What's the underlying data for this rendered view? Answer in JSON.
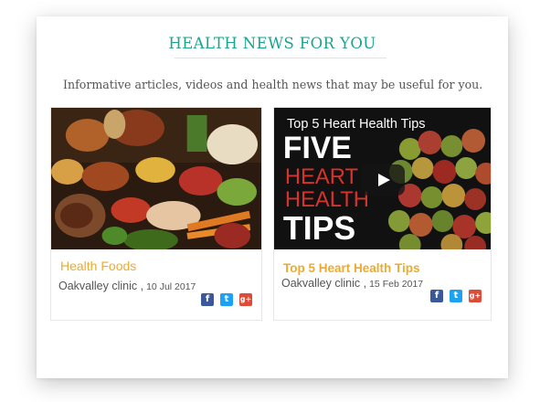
{
  "section": {
    "title": "HEALTH NEWS FOR YOU",
    "subtitle": "Informative articles, videos and health news that may be useful for you."
  },
  "articles": [
    {
      "title": "Health Foods",
      "source": "Oakvalley clinic ,",
      "date": "10 Jul 2017",
      "share": [
        "facebook-icon",
        "twitter-icon",
        "google-plus-icon"
      ]
    },
    {
      "title": "Top 5 Heart Health Tips",
      "source": "Oakvalley clinic ,",
      "date": "15 Feb 2017",
      "video_title": "Top 5 Heart Health Tips",
      "video_words": [
        "FIVE",
        "HEART",
        "HEALTH",
        "TIPS"
      ],
      "share": [
        "facebook-icon",
        "twitter-icon",
        "google-plus-icon"
      ]
    }
  ],
  "share_glyphs": {
    "facebook": "f",
    "twitter": "t",
    "googleplus": "g+"
  },
  "colors": {
    "heading": "#1aa38e",
    "article_title": "#efaa2e",
    "facebook": "#3b5998",
    "twitter": "#1da1f2",
    "googleplus": "#dd4b39",
    "video_heart_red": "#d8322c"
  }
}
